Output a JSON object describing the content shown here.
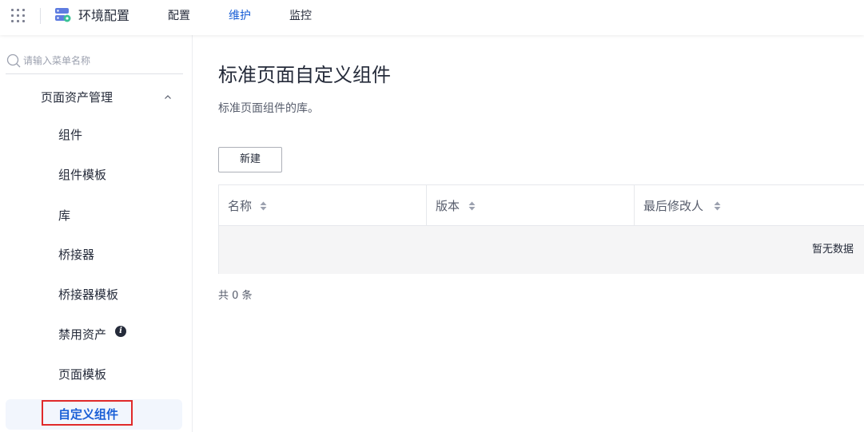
{
  "topbar": {
    "app_title": "环境配置",
    "nav": [
      {
        "label": "配置",
        "active": false
      },
      {
        "label": "维护",
        "active": true
      },
      {
        "label": "监控",
        "active": false
      }
    ]
  },
  "sidebar": {
    "search_placeholder": "请输入菜单名称",
    "group": {
      "label": "页面资产管理",
      "expanded": true
    },
    "items": [
      {
        "label": "组件"
      },
      {
        "label": "组件模板"
      },
      {
        "label": "库"
      },
      {
        "label": "桥接器"
      },
      {
        "label": "桥接器模板"
      },
      {
        "label": "禁用资产",
        "info_icon": "i"
      },
      {
        "label": "页面模板"
      },
      {
        "label": "自定义组件",
        "active": true
      }
    ]
  },
  "main": {
    "title": "标准页面自定义组件",
    "description": "标准页面组件的库。",
    "new_button": "新建",
    "table": {
      "columns": [
        "名称",
        "版本",
        "最后修改人"
      ],
      "empty_text": "暂无数据"
    },
    "total": "共 0 条"
  },
  "colors": {
    "accent": "#1a5fd6",
    "highlight_border": "#e02a2a",
    "active_item_bg": "#f2f6fd"
  }
}
